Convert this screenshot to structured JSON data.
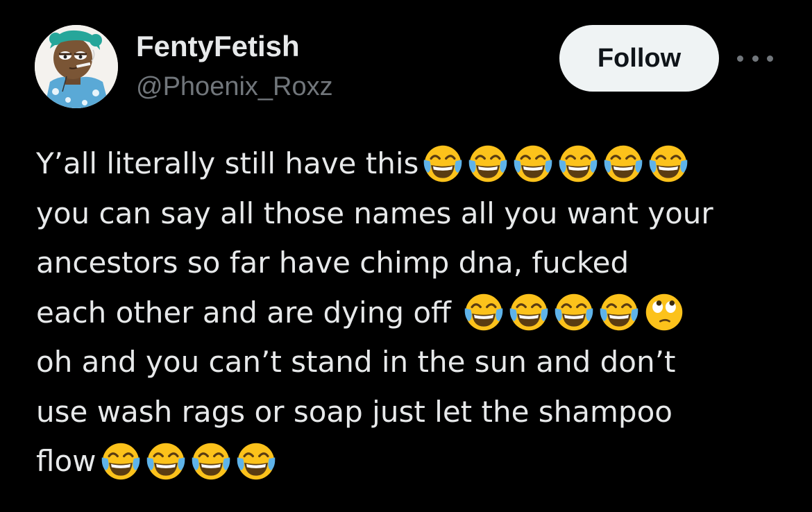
{
  "author": {
    "display_name": "FentyFetish",
    "handle": "@Phoenix_Roxz"
  },
  "actions": {
    "follow_label": "Follow",
    "more_icon": "more-horizontal-icon"
  },
  "tweet": {
    "lines": [
      "Y’all literally still have this",
      "you can say all those names all you want your",
      "ancestors so far have chimp dna, fucked",
      "each other and are dying off",
      "oh and you can’t stand in the sun and don’t",
      "use wash rags or soap just let the shampoo",
      "flow"
    ],
    "emojis": {
      "tears_of_joy": "😂",
      "eye_roll": "🙄"
    }
  },
  "colors": {
    "background": "#000000",
    "text": "#e7e9ea",
    "secondary_text": "#71767b",
    "follow_button_bg": "#eff3f4",
    "emoji_yellow": "#fcc21b",
    "emoji_tear": "#5eb3ea"
  }
}
